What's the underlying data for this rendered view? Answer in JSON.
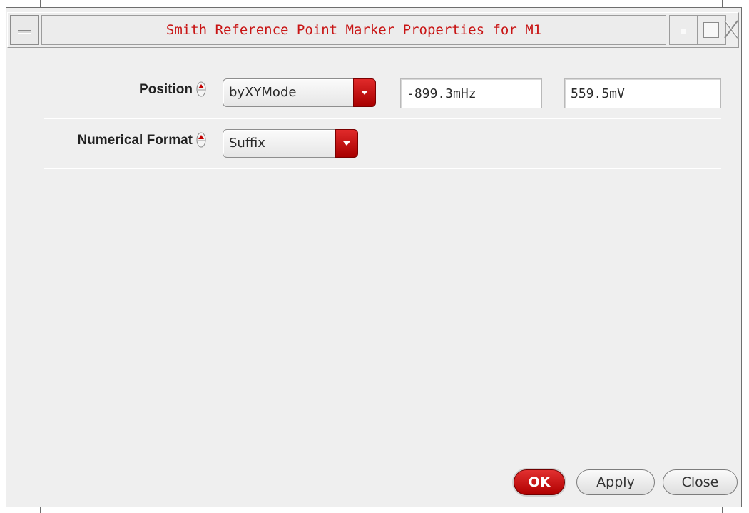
{
  "window": {
    "title": "Smith Reference Point Marker Properties for M1"
  },
  "form": {
    "position": {
      "label": "Position",
      "mode": "byXYMode",
      "x_value": "-899.3mHz",
      "y_value": "559.5mV"
    },
    "numerical_format": {
      "label": "Numerical Format",
      "value": "Suffix"
    }
  },
  "buttons": {
    "ok": "OK",
    "apply": "Apply",
    "close": "Close"
  },
  "colors": {
    "accent_red": "#c81414",
    "button_red": "#b00000",
    "background": "#efefef"
  },
  "icons": {
    "window_menu": "window-menu-icon",
    "minimize": "minimize-icon",
    "maximize": "maximize-icon",
    "close": "close-icon",
    "spin": "spin-indicator-icon",
    "dropdown": "chevron-down-icon"
  }
}
